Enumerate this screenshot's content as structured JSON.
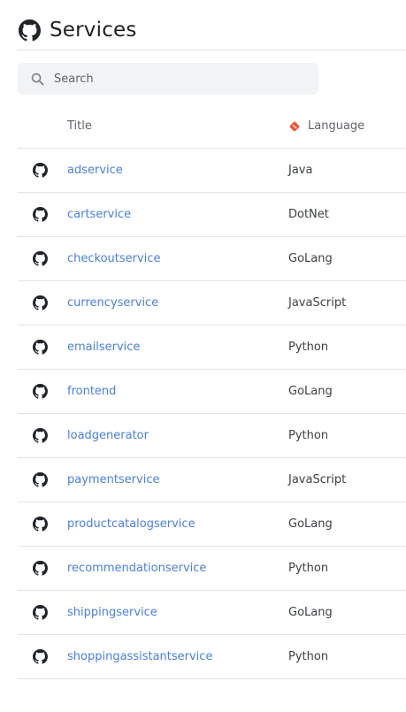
{
  "header": {
    "title": "Services",
    "icon": "github-icon"
  },
  "search": {
    "placeholder": "Search",
    "value": ""
  },
  "table": {
    "columns": {
      "title": "Title",
      "language": "Language",
      "language_icon": "git-icon"
    },
    "rows": [
      {
        "title": "adservice",
        "language": "Java"
      },
      {
        "title": "cartservice",
        "language": "DotNet"
      },
      {
        "title": "checkoutservice",
        "language": "GoLang"
      },
      {
        "title": "currencyservice",
        "language": "JavaScript"
      },
      {
        "title": "emailservice",
        "language": "Python"
      },
      {
        "title": "frontend",
        "language": "GoLang"
      },
      {
        "title": "loadgenerator",
        "language": "Python"
      },
      {
        "title": "paymentservice",
        "language": "JavaScript"
      },
      {
        "title": "productcatalogservice",
        "language": "GoLang"
      },
      {
        "title": "recommendationservice",
        "language": "Python"
      },
      {
        "title": "shippingservice",
        "language": "GoLang"
      },
      {
        "title": "shoppingassistantservice",
        "language": "Python"
      }
    ]
  },
  "colors": {
    "link": "#4a7ee0",
    "git_accent": "#f05133",
    "divider": "#e4e4e7",
    "search_bg": "#f1f3f4"
  }
}
